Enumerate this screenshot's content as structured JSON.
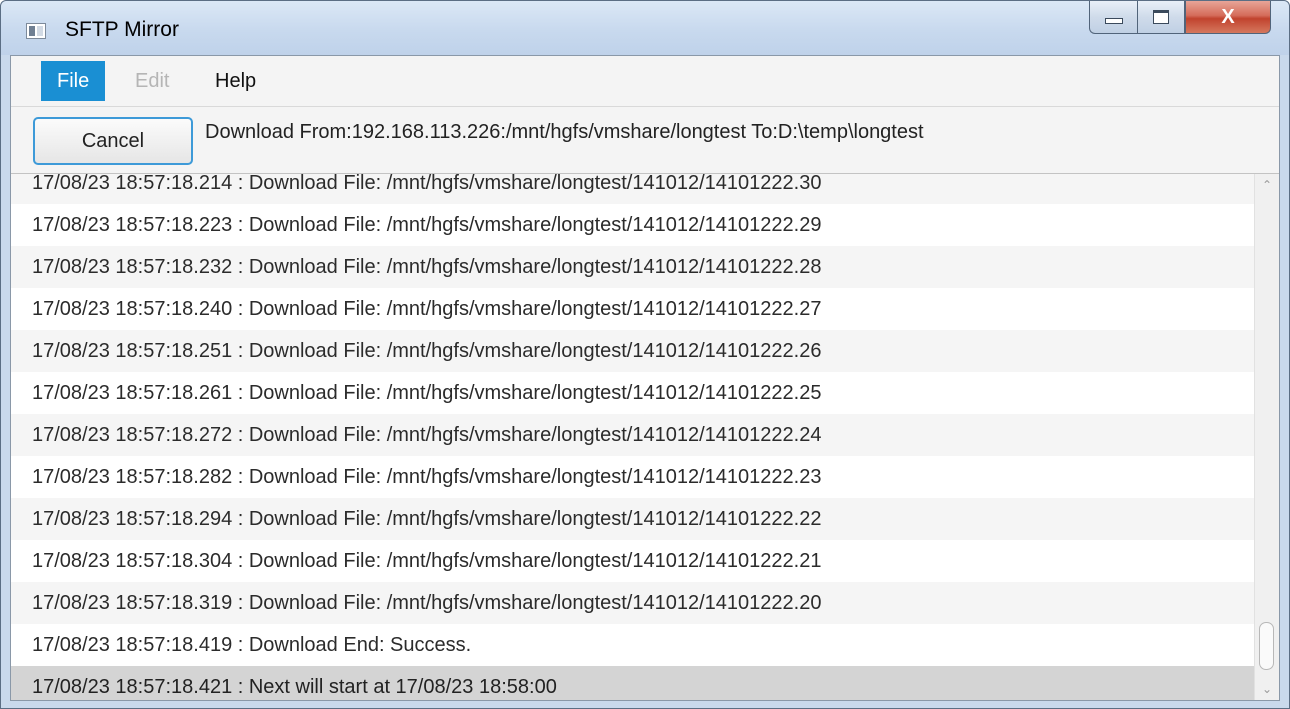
{
  "window": {
    "title": "SFTP Mirror",
    "close_glyph": "X"
  },
  "menu": {
    "items": [
      {
        "label": "File",
        "state": "active"
      },
      {
        "label": "Edit",
        "state": "disabled"
      },
      {
        "label": "Help",
        "state": "normal"
      }
    ]
  },
  "toolbar": {
    "cancel_label": "Cancel",
    "status": "Download From:192.168.113.226:/mnt/hgfs/vmshare/longtest To:D:\\temp\\longtest"
  },
  "log": {
    "entries": [
      "17/08/23 18:57:18.214 : Download File: /mnt/hgfs/vmshare/longtest/141012/14101222.30",
      "17/08/23 18:57:18.223 : Download File: /mnt/hgfs/vmshare/longtest/141012/14101222.29",
      "17/08/23 18:57:18.232 : Download File: /mnt/hgfs/vmshare/longtest/141012/14101222.28",
      "17/08/23 18:57:18.240 : Download File: /mnt/hgfs/vmshare/longtest/141012/14101222.27",
      "17/08/23 18:57:18.251 : Download File: /mnt/hgfs/vmshare/longtest/141012/14101222.26",
      "17/08/23 18:57:18.261 : Download File: /mnt/hgfs/vmshare/longtest/141012/14101222.25",
      "17/08/23 18:57:18.272 : Download File: /mnt/hgfs/vmshare/longtest/141012/14101222.24",
      "17/08/23 18:57:18.282 : Download File: /mnt/hgfs/vmshare/longtest/141012/14101222.23",
      "17/08/23 18:57:18.294 : Download File: /mnt/hgfs/vmshare/longtest/141012/14101222.22",
      "17/08/23 18:57:18.304 : Download File: /mnt/hgfs/vmshare/longtest/141012/14101222.21",
      "17/08/23 18:57:18.319 : Download File: /mnt/hgfs/vmshare/longtest/141012/14101222.20",
      "17/08/23 18:57:18.419 : Download End: Success.",
      "17/08/23 18:57:18.421 : Next will start at 17/08/23 18:58:00"
    ],
    "selected_index": 12
  },
  "icons": {
    "app": "app-window-icon",
    "minimize": "minimize-icon",
    "maximize": "maximize-icon",
    "close": "close-icon",
    "scroll_up": "chevron-up-icon",
    "scroll_down": "chevron-down-icon"
  },
  "colors": {
    "menu_active": "#1a8fd3",
    "button_focus_border": "#3d9ad8",
    "selected_row": "#d4d4d4",
    "close_button": "#c1432e"
  }
}
